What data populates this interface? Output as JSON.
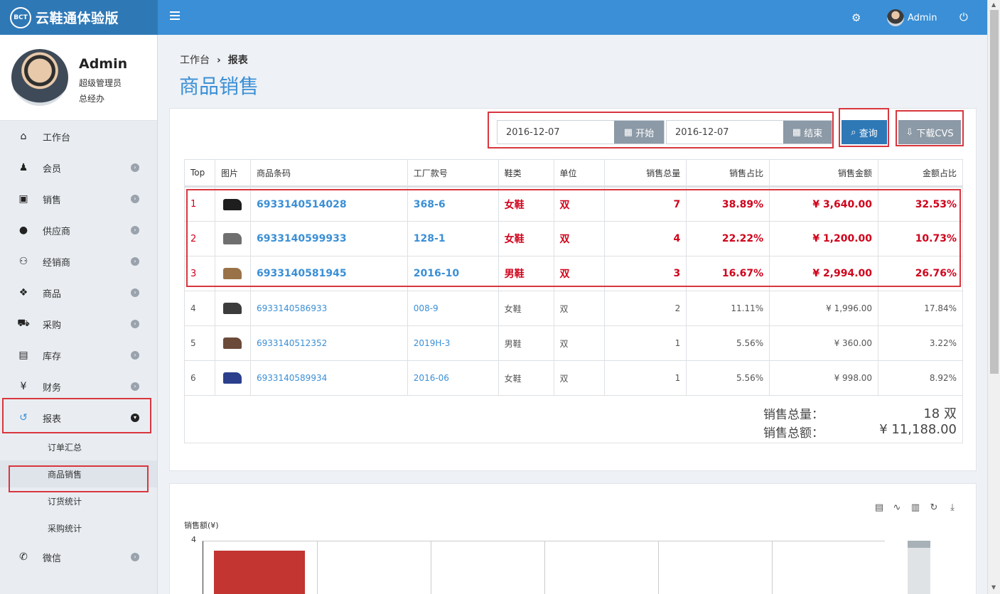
{
  "brand": {
    "logo": "BCT",
    "name": "云鞋通体验版"
  },
  "topbar": {
    "user": "Admin"
  },
  "profile": {
    "name": "Admin",
    "role": "超级管理员",
    "dept": "总经办"
  },
  "nav": [
    {
      "label": "工作台",
      "icon": "home-icon",
      "glyph": "⌂"
    },
    {
      "label": "会员",
      "icon": "person-icon",
      "glyph": "♟"
    },
    {
      "label": "销售",
      "icon": "money-icon",
      "glyph": "▣"
    },
    {
      "label": "供应商",
      "icon": "user-icon",
      "glyph": "●"
    },
    {
      "label": "经销商",
      "icon": "users-icon",
      "glyph": "⚇"
    },
    {
      "label": "商品",
      "icon": "cubes-icon",
      "glyph": "❖"
    },
    {
      "label": "采购",
      "icon": "cart-icon",
      "glyph": "⛟"
    },
    {
      "label": "库存",
      "icon": "inventory-icon",
      "glyph": "▤"
    },
    {
      "label": "财务",
      "icon": "yen-icon",
      "glyph": "¥"
    },
    {
      "label": "报表",
      "icon": "history-icon",
      "glyph": "↺"
    }
  ],
  "subnav": [
    "订单汇总",
    "商品销售",
    "订货统计",
    "采购统计"
  ],
  "nav_after": {
    "label": "微信",
    "icon": "wechat-icon",
    "glyph": "✆"
  },
  "breadcrumb": {
    "home": "工作台",
    "sep": "›",
    "current": "报表"
  },
  "page_title": "商品销售",
  "filters": {
    "start_date": "2016-12-07",
    "start_label": "开始",
    "end_date": "2016-12-07",
    "end_label": "结束",
    "query_label": "查询",
    "download_label": "下载CVS"
  },
  "table": {
    "headers": [
      "Top",
      "图片",
      "商品条码",
      "工厂款号",
      "鞋类",
      "单位",
      "销售总量",
      "销售占比",
      "销售金额",
      "金额占比"
    ],
    "rows": [
      {
        "rank": "1",
        "shoe_color": "#1e1e1e",
        "barcode": "6933140514028",
        "style": "368-6",
        "kind": "女鞋",
        "unit": "双",
        "qty": "7",
        "qty_pct": "38.89%",
        "amount": "¥ 3,640.00",
        "amount_pct": "32.53%"
      },
      {
        "rank": "2",
        "shoe_color": "#6f6f6f",
        "barcode": "6933140599933",
        "style": "128-1",
        "kind": "女鞋",
        "unit": "双",
        "qty": "4",
        "qty_pct": "22.22%",
        "amount": "¥ 1,200.00",
        "amount_pct": "10.73%"
      },
      {
        "rank": "3",
        "shoe_color": "#9a7248",
        "barcode": "6933140581945",
        "style": "2016-10",
        "kind": "男鞋",
        "unit": "双",
        "qty": "3",
        "qty_pct": "16.67%",
        "amount": "¥ 2,994.00",
        "amount_pct": "26.76%"
      },
      {
        "rank": "4",
        "shoe_color": "#3c3c3c",
        "barcode": "6933140586933",
        "style": "008-9",
        "kind": "女鞋",
        "unit": "双",
        "qty": "2",
        "qty_pct": "11.11%",
        "amount": "¥ 1,996.00",
        "amount_pct": "17.84%"
      },
      {
        "rank": "5",
        "shoe_color": "#6b4a3a",
        "barcode": "6933140512352",
        "style": "2019H-3",
        "kind": "男鞋",
        "unit": "双",
        "qty": "1",
        "qty_pct": "5.56%",
        "amount": "¥ 360.00",
        "amount_pct": "3.22%"
      },
      {
        "rank": "6",
        "shoe_color": "#2b3f8c",
        "barcode": "6933140589934",
        "style": "2016-06",
        "kind": "女鞋",
        "unit": "双",
        "qty": "1",
        "qty_pct": "5.56%",
        "amount": "¥ 998.00",
        "amount_pct": "8.92%"
      }
    ]
  },
  "summary": {
    "qty_label": "销售总量：",
    "qty_value": "18 双",
    "amount_label": "销售总额：",
    "amount_value": "¥ 11,188.00"
  },
  "chart_toolbar": [
    "data-view-icon",
    "line-chart-icon",
    "bar-chart-icon",
    "refresh-icon",
    "download-icon"
  ],
  "chart_data": {
    "type": "bar",
    "ylabel": "销售额(¥)",
    "y_ticks": [
      "4"
    ],
    "ylim": [
      0,
      4
    ],
    "categories": [
      "",
      "",
      "",
      "",
      "",
      ""
    ],
    "values": [
      3.5,
      null,
      null,
      null,
      null,
      null
    ],
    "color": "#c23531"
  }
}
